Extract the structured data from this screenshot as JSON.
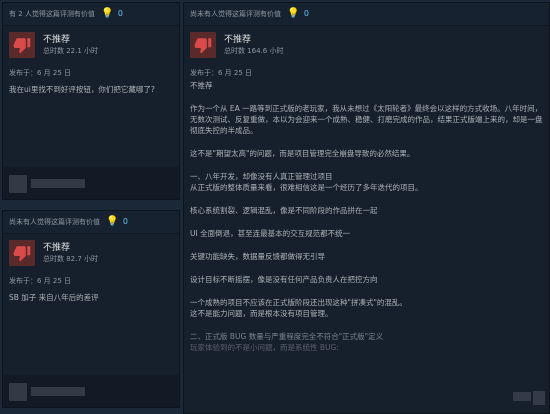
{
  "cards": [
    {
      "helpful_text": "有 2 人觉得这篇评测有价值",
      "helpful_count": "0",
      "verdict": "不推荐",
      "hours": "总时数 22.1 小时",
      "posted": "发布于：6 月 25 日",
      "body": [
        "我在ui里找不到好评按钮，你们把它藏哪了?"
      ]
    },
    {
      "helpful_text": "尚未有人觉得这篇评测有价值",
      "helpful_count": "0",
      "verdict": "不推荐",
      "hours": "总时数 82.7 小时",
      "posted": "发布于：6 月 25 日",
      "body": [
        "SB 加子 来自八年后的差评"
      ]
    },
    {
      "helpful_text": "尚未有人觉得这篇评测有价值",
      "helpful_count": "0",
      "verdict": "不推荐",
      "hours": "总时数 164.6 小时",
      "posted": "发布于：6 月 25 日",
      "body": [
        "不推荐",
        "作为一个从 EA 一路等到正式版的老玩家，我从未想过《太阳轮者》最终会以这样的方式收场。八年时间，无数次测试、反复重做，本以为会迎来一个成熟、稳健、打磨完成的作品，结果正式版端上来的，却是一盘彻底失控的半成品。",
        "这不是\"期望太高\"的问题，而是项目管理完全崩盘导致的必然结果。",
        "一、八年开发，却像没有人真正管理过项目",
        "从正式版的整体质量来看，很难相信这是一个经历了多年迭代的项目。",
        "核心系统割裂、逻辑混乱，像是不同阶段的作品拼在一起",
        "UI 全面倒退，甚至连最基本的交互规范都不统一",
        "关键功能缺失，数据量反馈都做得无引导",
        "设计目标不断摇摆，像是没有任何产品负责人在把控方向",
        "一个成熟的项目不应该在正式版阶段还出现这种\"拼凑式\"的混乱。",
        "这不是能力问题，而是根本没有项目管理。",
        "二、正式版 BUG 数量与严重程度完全不符合\"正式版\"定义",
        "玩家体验到的不是小问题，而是系统性 BUG:"
      ]
    }
  ]
}
